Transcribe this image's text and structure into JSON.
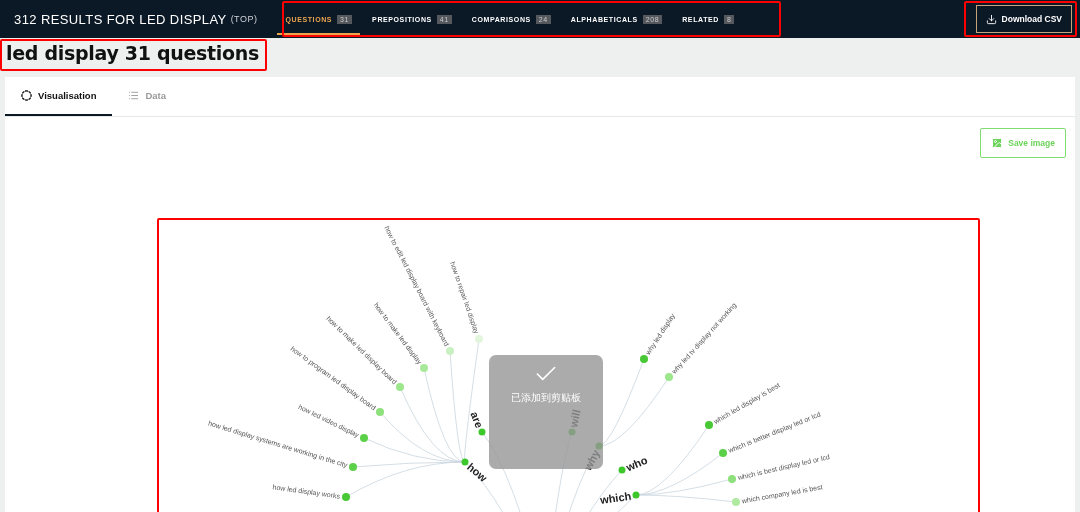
{
  "header": {
    "title": "312 RESULTS FOR LED DISPLAY",
    "suffix": "(TOP)",
    "download_button": "Download CSV",
    "tabs": [
      {
        "label": "QUESTIONS",
        "count": "31",
        "selected": true
      },
      {
        "label": "PREPOSITIONS",
        "count": "41",
        "selected": false
      },
      {
        "label": "COMPARISONS",
        "count": "24",
        "selected": false
      },
      {
        "label": "ALPHABETICALS",
        "count": "208",
        "selected": false
      },
      {
        "label": "RELATED",
        "count": "8",
        "selected": false
      }
    ]
  },
  "heading": "led display 31 questions",
  "view_tabs": [
    {
      "label": "Visualisation",
      "kind": "visual",
      "selected": true
    },
    {
      "label": "Data",
      "kind": "list",
      "selected": false
    }
  ],
  "save_button": "Save image",
  "toast": "已添加到剪贴板",
  "branches": [
    {
      "label": "how",
      "children": [
        {
          "label": "how to edit led display board with keyboard",
          "color": "#c8f0c0"
        },
        {
          "label": "how to repair led display",
          "color": "#e2f6de"
        },
        {
          "label": "how to make led display",
          "color": "#a8e89a"
        },
        {
          "label": "how to make led display board",
          "color": "#9ce68c"
        },
        {
          "label": "how to program led display board",
          "color": "#8ee07c"
        },
        {
          "label": "how led video display",
          "color": "#5cd048"
        },
        {
          "label": "how led display systems are working in the city",
          "color": "#5cd048"
        },
        {
          "label": "how led display works",
          "color": "#48c834"
        }
      ]
    },
    {
      "label": "are"
    },
    {
      "label": "will"
    },
    {
      "label": "why",
      "children": [
        {
          "label": "why led display",
          "color": "#48c834"
        },
        {
          "label": "why led tv display not working",
          "color": "#9ce68c"
        }
      ]
    },
    {
      "label": "who"
    },
    {
      "label": "which",
      "children": [
        {
          "label": "which led display is best",
          "color": "#48c834"
        },
        {
          "label": "which is better display led or lcd",
          "color": "#5cd048"
        },
        {
          "label": "which is best display led or lcd",
          "color": "#8ee07c"
        },
        {
          "label": "which company led is best",
          "color": "#b0eaa0"
        }
      ]
    }
  ]
}
